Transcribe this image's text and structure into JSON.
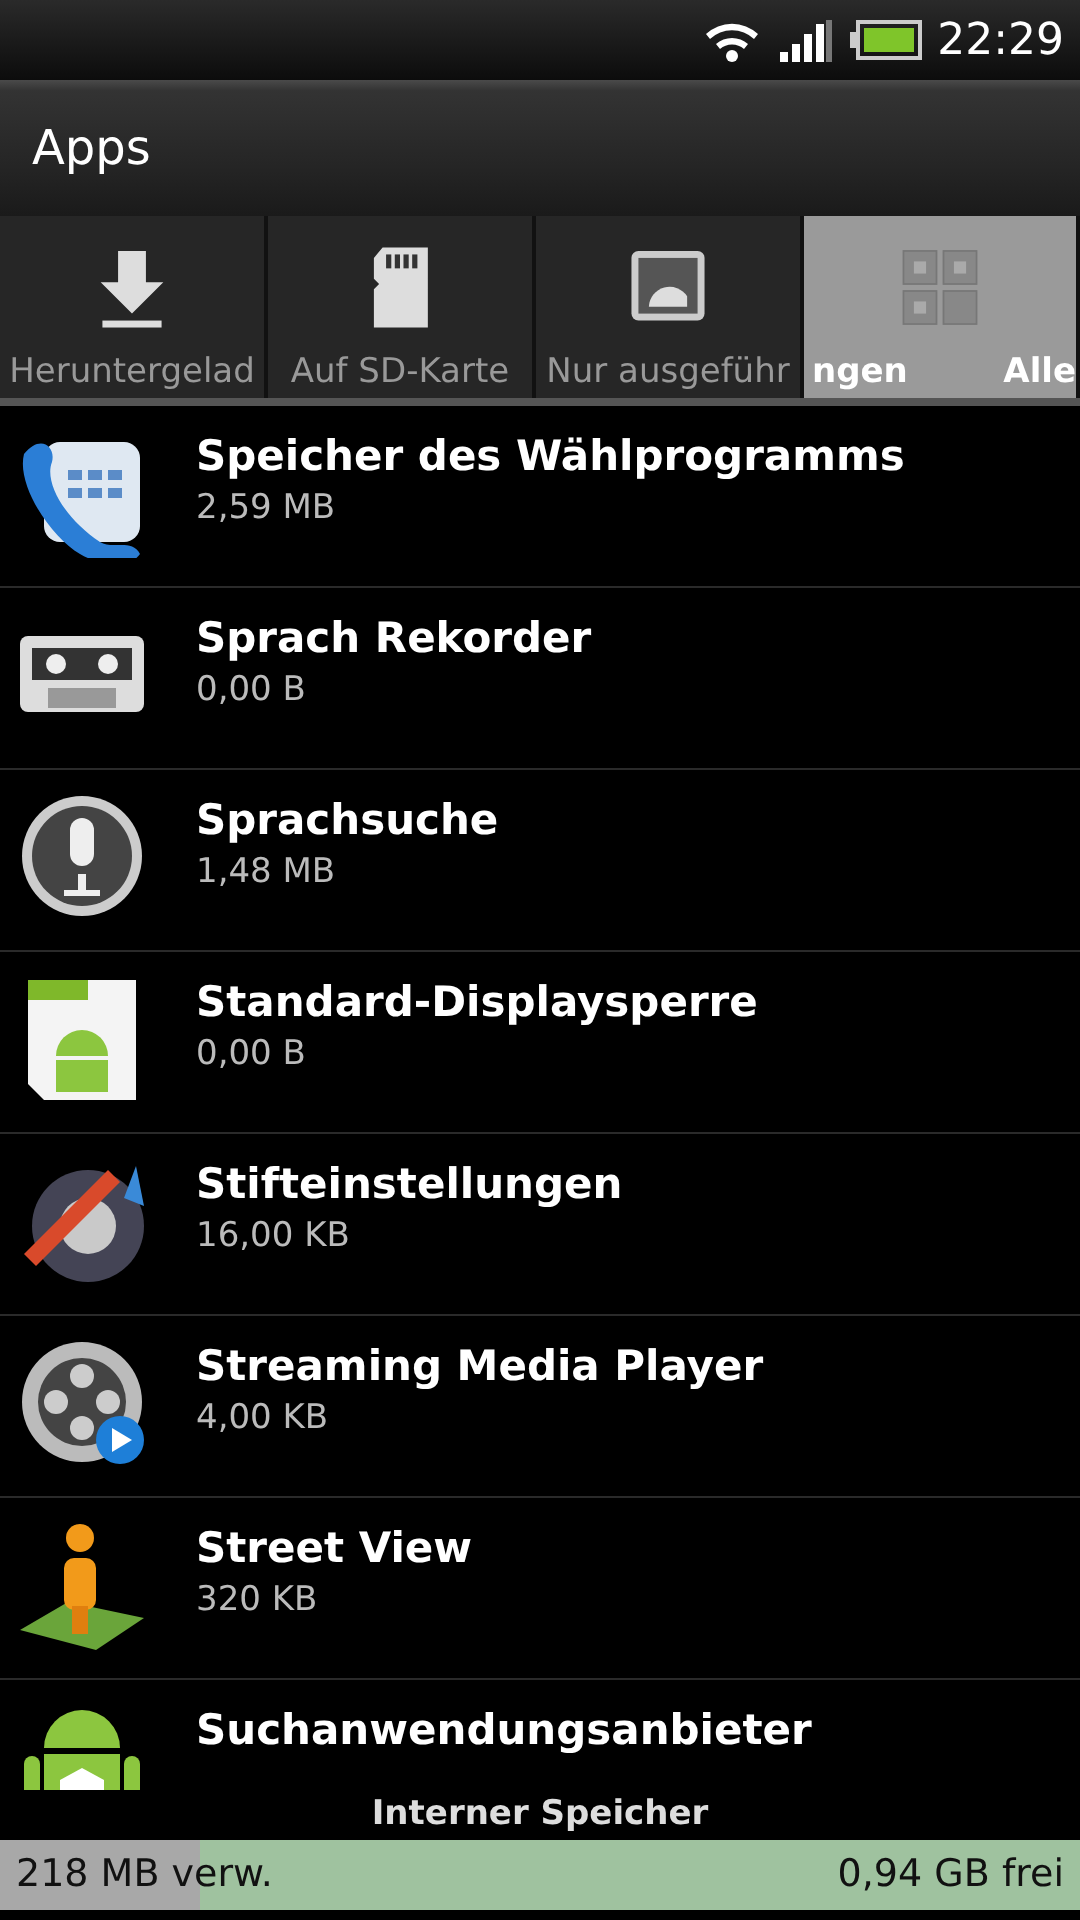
{
  "status_bar": {
    "time": "22:29"
  },
  "title": "Apps",
  "tabs": [
    {
      "label": "Heruntergelad",
      "selected": false
    },
    {
      "label": "Auf SD-Karte",
      "selected": false
    },
    {
      "label": "Nur ausgeführ",
      "selected": false
    },
    {
      "label": "Alle",
      "prefix": "ngen",
      "selected": true
    }
  ],
  "apps": [
    {
      "name": "Speicher des Wählprogramms",
      "size": "2,59 MB"
    },
    {
      "name": "Sprach Rekorder",
      "size": "0,00 B"
    },
    {
      "name": "Sprachsuche",
      "size": "1,48 MB"
    },
    {
      "name": "Standard-Displaysperre",
      "size": "0,00 B"
    },
    {
      "name": "Stifteinstellungen",
      "size": "16,00 KB"
    },
    {
      "name": "Streaming Media Player",
      "size": "4,00 KB"
    },
    {
      "name": "Street View",
      "size": "320 KB"
    },
    {
      "name": "Suchanwendungsanbieter"
    }
  ],
  "storage": {
    "title": "Interner Speicher",
    "used": "218 MB verw.",
    "free": "0,94 GB frei",
    "level": 0.185
  }
}
